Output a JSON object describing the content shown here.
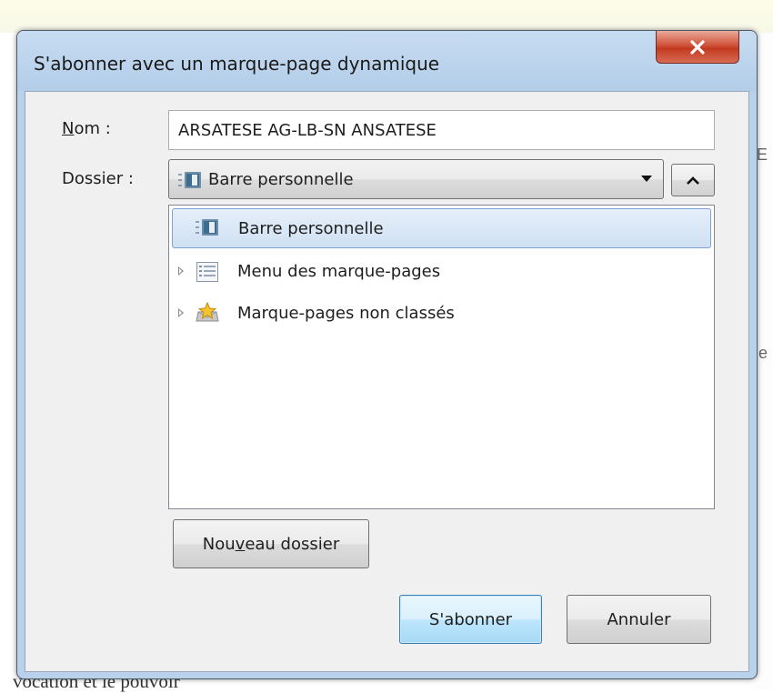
{
  "dialog": {
    "title": "S'abonner avec un marque-page dynamique",
    "close_icon": "close-icon"
  },
  "form": {
    "name_label_accel": "N",
    "name_label_rest": "om :",
    "name_value": "ARSATESE AG-LB-SN ANSATESE",
    "folder_label": "Dossier :",
    "folder_selected": "Barre personnelle",
    "folder_selected_icon": "toolbar-folder-icon"
  },
  "tree": {
    "items": [
      {
        "label": "Barre personnelle",
        "icon": "toolbar-folder-icon",
        "selected": true,
        "expandable": false
      },
      {
        "label": "Menu des marque-pages",
        "icon": "bookmarks-menu-icon",
        "selected": false,
        "expandable": true
      },
      {
        "label": "Marque-pages non classés",
        "icon": "unsorted-bookmarks-icon",
        "selected": false,
        "expandable": true
      }
    ]
  },
  "buttons": {
    "new_folder_pre": "Nou",
    "new_folder_accel": "v",
    "new_folder_post": "eau dossier",
    "subscribe": "S'abonner",
    "cancel": "Annuler"
  },
  "background": {
    "bottom_text": "vocation et le pouvoir",
    "right_fragment_1": "E",
    "right_fragment_2": "e"
  },
  "colors": {
    "title_bar": "#b9d1ea",
    "client_bg": "#f0f0f0",
    "selection": "#cfe0f2",
    "close_red": "#c23a20"
  }
}
